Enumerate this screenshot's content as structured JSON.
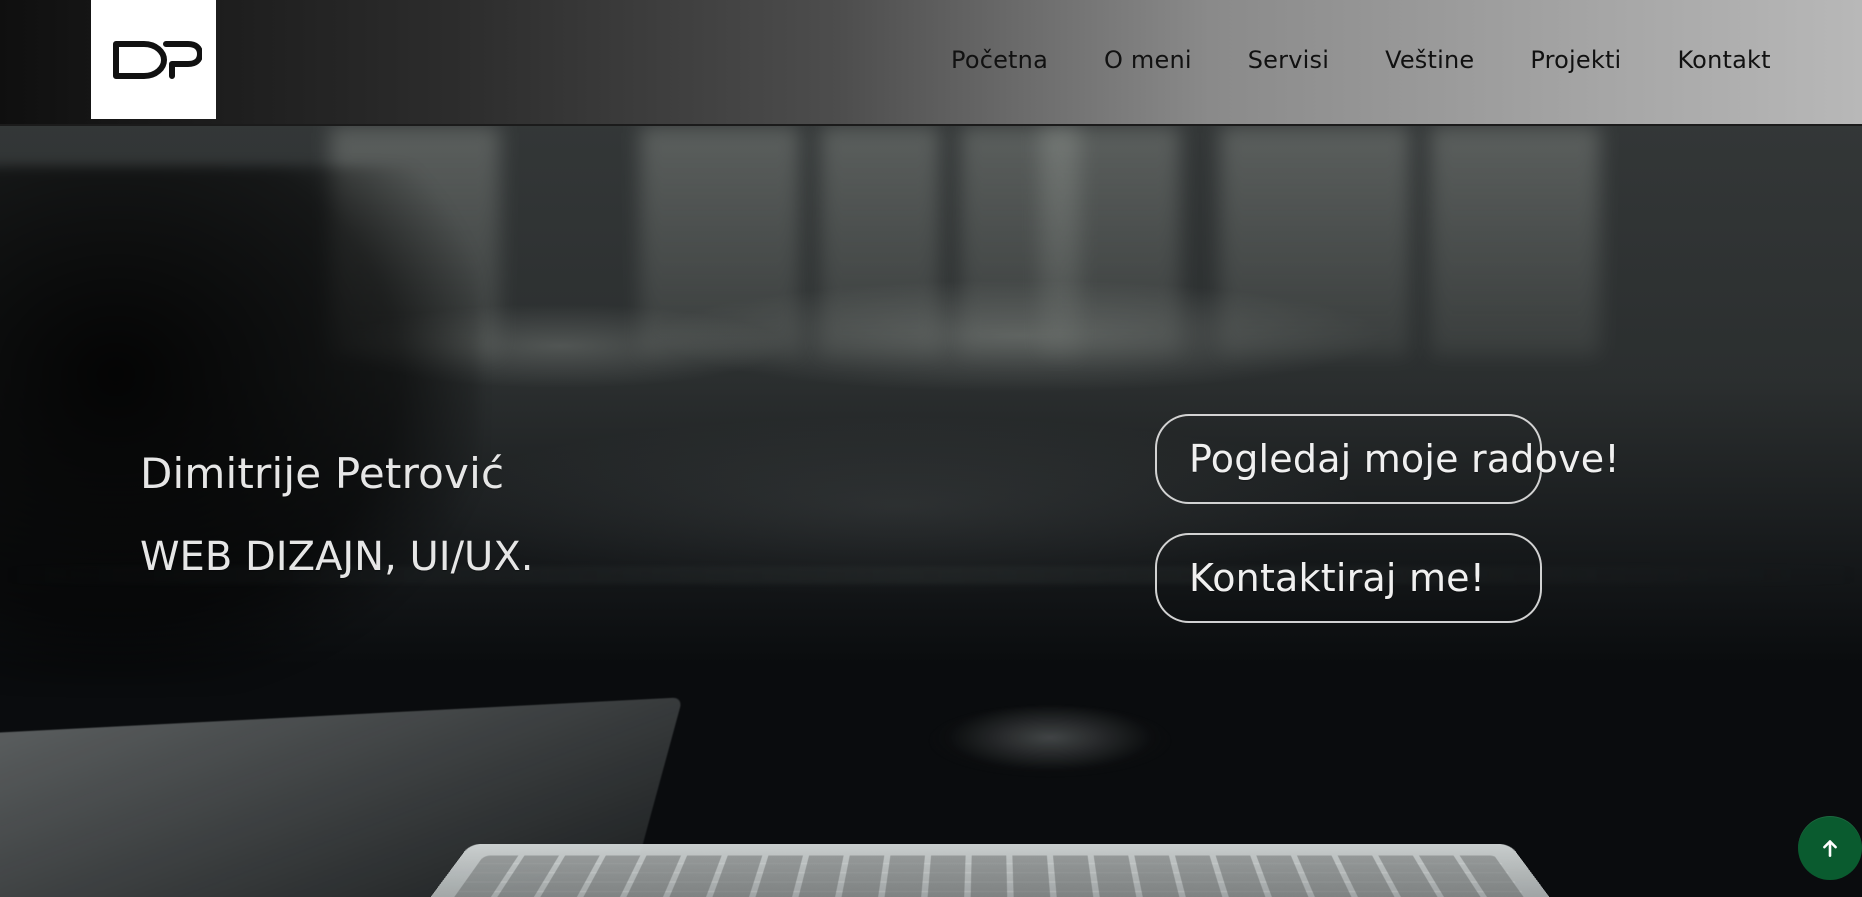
{
  "brand": {
    "logo_text": "DP"
  },
  "nav": {
    "items": [
      {
        "label": "Početna"
      },
      {
        "label": "O meni"
      },
      {
        "label": "Servisi"
      },
      {
        "label": "Veštine"
      },
      {
        "label": "Projekti"
      },
      {
        "label": "Kontakt"
      }
    ]
  },
  "hero": {
    "name": "Dimitrije Petrović",
    "role": "WEB DIZAJN, UI/UX.",
    "cta_primary_label": "Pogledaj moje radove!",
    "cta_secondary_label": "Kontaktiraj me!"
  },
  "theme": {
    "accent_green": "#0A5B2F",
    "text_light": "#E6E6E6",
    "header_dark": "#0F0F0F",
    "header_light": "#B8B8B8"
  },
  "icons": {
    "scroll_top": "arrow-up-icon"
  }
}
